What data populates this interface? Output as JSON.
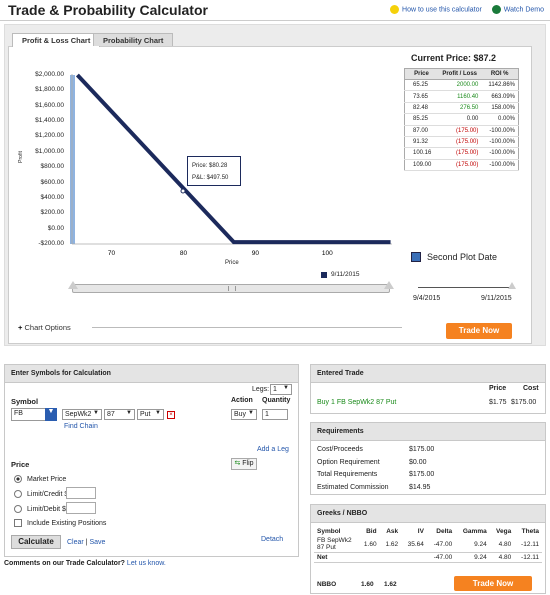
{
  "header": {
    "title": "Trade & Probability Calculator",
    "help_link": "How to use this calculator",
    "demo_link": "Watch Demo"
  },
  "tabs": [
    {
      "label": "Profit & Loss Chart"
    },
    {
      "label": "Probability Chart"
    }
  ],
  "chart": {
    "yticks": [
      "$2,000.00",
      "$1,800.00",
      "$1,600.00",
      "$1,400.00",
      "$1,200.00",
      "$1,000.00",
      "$800.00",
      "$600.00",
      "$400.00",
      "$200.00",
      "$0.00",
      "-$200.00"
    ],
    "xticks": [
      "70",
      "80",
      "90",
      "100"
    ],
    "ylabel": "Profit",
    "xlabel": "Price",
    "tooltip_price": "Price: $80.28",
    "tooltip_pl": "P&L: $497.50",
    "legend": "9/11/2015",
    "series_color": "#1c2a5c"
  },
  "chart_data": {
    "type": "line",
    "title": "",
    "xlabel": "Price",
    "ylabel": "Profit",
    "x": [
      65.25,
      87,
      108.8
    ],
    "series": [
      {
        "name": "9/11/2015",
        "values": [
          2000,
          -175,
          -175
        ]
      }
    ],
    "xlim": [
      64.5,
      109
    ],
    "ylim": [
      -200,
      2000
    ]
  },
  "price_panel": {
    "title": "Current Price: $87.2",
    "headers": [
      "Price",
      "Profit / Loss",
      "ROI %"
    ],
    "rows": [
      {
        "price": "65.25",
        "pl": "2000.00",
        "roi": "1142.86%",
        "cls": "pos"
      },
      {
        "price": "73.65",
        "pl": "1160.40",
        "roi": "663.09%",
        "cls": "pos"
      },
      {
        "price": "82.48",
        "pl": "276.50",
        "roi": "158.00%",
        "cls": "pos"
      },
      {
        "price": "85.25",
        "pl": "0.00",
        "roi": "0.00%",
        "cls": ""
      },
      {
        "price": "87.00",
        "pl": "(175.00)",
        "roi": "-100.00%",
        "cls": "neg"
      },
      {
        "price": "91.32",
        "pl": "(175.00)",
        "roi": "-100.00%",
        "cls": "neg"
      },
      {
        "price": "100.16",
        "pl": "(175.00)",
        "roi": "-100.00%",
        "cls": "neg"
      },
      {
        "price": "109.00",
        "pl": "(175.00)",
        "roi": "-100.00%",
        "cls": "neg"
      }
    ]
  },
  "second_plot": {
    "label": "Second Plot Date",
    "date_start": "9/4/2015",
    "date_end": "9/11/2015"
  },
  "chart_options": {
    "plus": "+",
    "label": "Chart Options"
  },
  "trade_now": "Trade Now",
  "symbols": {
    "header": "Enter Symbols for Calculation",
    "legs_label": "Legs:",
    "legs_value": "1",
    "symbol_label": "Symbol",
    "action_label": "Action",
    "quantity_label": "Quantity",
    "symbol_value": "FB",
    "expiry": "SepWk2",
    "strike": "87",
    "type": "Put",
    "action": "Buy",
    "quantity": "1",
    "find_chain": "Find Chain",
    "add_leg": "Add a Leg",
    "flip": "Flip",
    "price_label": "Price",
    "market_price": "Market Price",
    "limit_credit": "Limit/Credit $",
    "limit_debit": "Limit/Debit $",
    "include_existing": "Include Existing Positions",
    "calculate": "Calculate",
    "clear": "Clear",
    "sep": "|",
    "save": "Save",
    "detach": "Detach"
  },
  "comments": {
    "text": "Comments on our Trade Calculator?",
    "link": "Let us know."
  },
  "entered_trade": {
    "header": "Entered Trade",
    "price_hdr": "Price",
    "cost_hdr": "Cost",
    "trade_text": "Buy 1 FB SepWk2 87 Put",
    "price": "$1.75",
    "cost": "$175.00"
  },
  "requirements": {
    "header": "Requirements",
    "rows": [
      {
        "label": "Cost/Proceeds",
        "value": "$175.00"
      },
      {
        "label": "Option Requirement",
        "value": "$0.00"
      },
      {
        "label": "Total Requirements",
        "value": "$175.00"
      },
      {
        "label": "Estimated Commission",
        "value": "$14.95"
      }
    ]
  },
  "greeks": {
    "header": "Greeks / NBBO",
    "columns": [
      "Symbol",
      "Bid",
      "Ask",
      "IV",
      "Delta",
      "Gamma",
      "Vega",
      "Theta"
    ],
    "row1": [
      "FB SepWk2 87 Put",
      "1.60",
      "1.62",
      "35.64",
      "-47.00",
      "9.24",
      "4.80",
      "-12.11"
    ],
    "net": [
      "Net",
      "",
      "",
      "",
      "-47.00",
      "9.24",
      "4.80",
      "-12.11"
    ],
    "nbbo": [
      "NBBO",
      "1.60",
      "1.62"
    ]
  }
}
